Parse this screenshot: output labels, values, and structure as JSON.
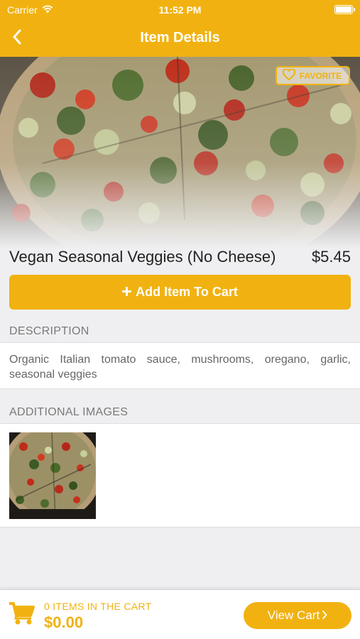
{
  "status_bar": {
    "carrier": "Carrier",
    "time": "11:52 PM"
  },
  "nav": {
    "title": "Item Details",
    "back_icon": "chevron-left-icon"
  },
  "hero": {
    "favorite_label": "FAVORITE",
    "favorite_icon": "heart-icon"
  },
  "item": {
    "name": "Vegan Seasonal Veggies (No Cheese)",
    "price": "$5.45"
  },
  "add_button": {
    "label": "Add Item To Cart",
    "icon": "plus-icon"
  },
  "description": {
    "header": "DESCRIPTION",
    "text": "Organic Italian tomato sauce, mushrooms, oregano, garlic, seasonal veggies"
  },
  "additional_images": {
    "header": "ADDITIONAL IMAGES"
  },
  "cart": {
    "count_text": "0 ITEMS IN THE CART",
    "total": "$0.00",
    "view_cart_label": "View Cart",
    "cart_icon": "shopping-cart-icon"
  },
  "colors": {
    "accent": "#f1b211",
    "background": "#efeff1"
  }
}
